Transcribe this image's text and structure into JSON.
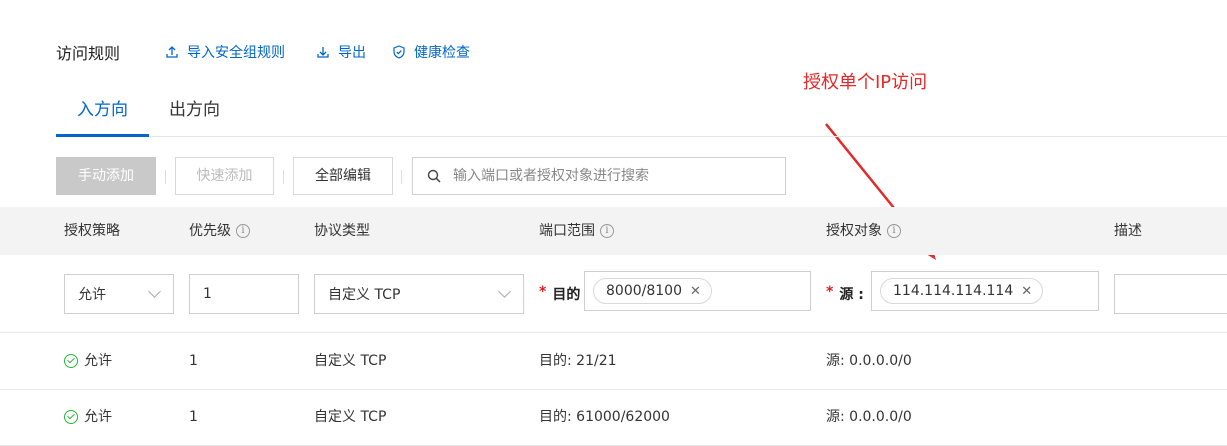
{
  "section": {
    "title": "访问规则"
  },
  "actions": [
    {
      "label": "导入安全组规则",
      "icon": "upload-icon"
    },
    {
      "label": "导出",
      "icon": "download-icon"
    },
    {
      "label": "健康检查",
      "icon": "shield-check-icon"
    }
  ],
  "tabs": {
    "inbound": "入方向",
    "outbound": "出方向",
    "active": "inbound"
  },
  "toolbar": {
    "manual_add": "手动添加",
    "quick_add": "快速添加",
    "edit_all": "全部编辑",
    "search_placeholder": "输入端口或者授权对象进行搜索"
  },
  "table": {
    "headers": [
      "授权策略",
      "优先级",
      "协议类型",
      "端口范围",
      "授权对象",
      "描述"
    ],
    "edit_row": {
      "policy": "允许",
      "priority": "1",
      "protocol": "自定义 TCP",
      "port_label": "目的",
      "port_tag": "8000/8100",
      "source_label": "源 :",
      "source_tag": "114.114.114.114",
      "description": ""
    },
    "rows": [
      {
        "policy": "允许",
        "priority": "1",
        "protocol": "自定义 TCP",
        "port": "目的: 21/21",
        "source": "源: 0.0.0.0/0"
      },
      {
        "policy": "允许",
        "priority": "1",
        "protocol": "自定义 TCP",
        "port": "目的: 61000/62000",
        "source": "源: 0.0.0.0/0"
      }
    ]
  },
  "annotation": {
    "text": "授权单个IP访问",
    "color": "#e52828"
  },
  "colors": {
    "accent": "#0066cc",
    "success": "#2db540",
    "required": "#e02020"
  }
}
